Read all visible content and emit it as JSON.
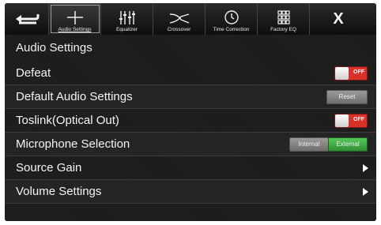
{
  "toolbar": {
    "back_icon": "back-arrow-icon",
    "tabs": [
      {
        "label": "Audio Settings",
        "icon": "plus-icon",
        "active": true
      },
      {
        "label": "Equalizer",
        "icon": "equalizer-sliders-icon",
        "active": false
      },
      {
        "label": "Crossover",
        "icon": "crossover-curve-icon",
        "active": false
      },
      {
        "label": "Time Correction",
        "icon": "clock-icon",
        "active": false
      },
      {
        "label": "Factory EQ",
        "icon": "grid-icon",
        "active": false
      }
    ],
    "close_label": "X"
  },
  "page": {
    "title": "Audio Settings",
    "rows": [
      {
        "label": "Defeat",
        "control": "toggle",
        "toggle_state": "OFF"
      },
      {
        "label": "Default Audio Settings",
        "control": "button",
        "button_label": "Reset"
      },
      {
        "label": "Toslink(Optical Out)",
        "control": "toggle",
        "toggle_state": "OFF"
      },
      {
        "label": "Microphone Selection",
        "control": "segmented",
        "options": [
          "Internal",
          "External"
        ],
        "selected": "External"
      },
      {
        "label": "Source Gain",
        "control": "arrow"
      },
      {
        "label": "Volume Settings",
        "control": "arrow"
      }
    ]
  },
  "colors": {
    "toggle_off": "#d9302a",
    "selected_option": "#3faa42",
    "background": "#1b1b1b"
  }
}
